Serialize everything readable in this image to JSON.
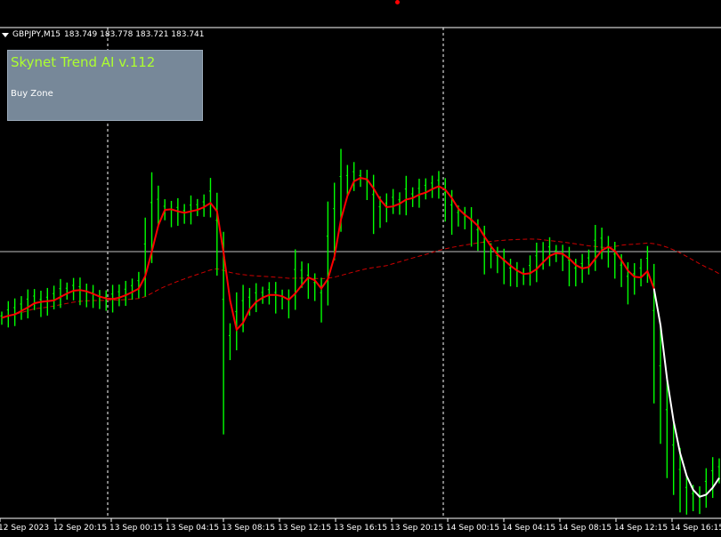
{
  "header": {
    "symbol": "GBPJPY,M15",
    "ohlc": "183.749 183.778 183.721 183.741"
  },
  "panel": {
    "title": "Skynet Trend AI v.112",
    "status": "Buy Zone"
  },
  "chart_data": {
    "type": "candlestick",
    "symbol": "GBPJPY",
    "timeframe": "M15",
    "last_ohlc": {
      "open": 183.749,
      "high": 183.778,
      "low": 183.721,
      "close": 183.741
    },
    "x_ticks": [
      "12 Sep 2023",
      "12 Sep 20:15",
      "13 Sep 00:15",
      "13 Sep 04:15",
      "13 Sep 08:15",
      "13 Sep 12:15",
      "13 Sep 16:15",
      "13 Sep 20:15",
      "14 Sep 00:15",
      "14 Sep 04:15",
      "14 Sep 08:15",
      "14 Sep 12:15",
      "14 Sep 16:15"
    ],
    "series": [
      {
        "name": "",
        "values": [
          183.52,
          183.56,
          183.58,
          183.62,
          183.66,
          183.7,
          183.66,
          183.68,
          183.72,
          183.76,
          183.78,
          183.8,
          183.78,
          183.74,
          183.73,
          183.7,
          183.69,
          183.71,
          183.74,
          183.76,
          183.8,
          183.84,
          184.12,
          184.5,
          184.6,
          184.56,
          184.52,
          184.54,
          184.52,
          184.56,
          184.58,
          184.6,
          184.68,
          184.34,
          183.42,
          183.3,
          183.5,
          183.62,
          183.68,
          183.72,
          183.74,
          183.76,
          183.72,
          183.7,
          183.66,
          183.9,
          183.94,
          183.88,
          183.82,
          183.7,
          184.16,
          184.46,
          184.76,
          184.84,
          184.88,
          184.86,
          184.8,
          184.62,
          184.54,
          184.58,
          184.64,
          184.62,
          184.7,
          184.68,
          184.72,
          184.76,
          184.78,
          184.8,
          184.66,
          184.54,
          184.5,
          184.48,
          184.4,
          184.32,
          184.18,
          184.12,
          184.08,
          184.02,
          183.96,
          183.94,
          183.92,
          183.98,
          184.06,
          184.12,
          184.16,
          184.14,
          184.1,
          184.02,
          183.96,
          184.0,
          184.06,
          184.2,
          184.24,
          184.16,
          184.08,
          183.98,
          183.86,
          183.9,
          183.96,
          184.04,
          183.4,
          182.9,
          182.5,
          182.2,
          181.98,
          181.84,
          181.8,
          181.78,
          181.9,
          182.0,
          182.06
        ]
      }
    ],
    "ylim": [
      181.6,
      186.3
    ],
    "grid": false
  },
  "colors": {
    "bull": "#00ff00",
    "bear": "#00ff00",
    "trend_line": "#ff0000",
    "trend_line_recent": "#ffffff",
    "ma_dashed": "#cc0000",
    "bid_line": "#c0c0c0",
    "separator": "#ffffff",
    "panel_bg": "#778899",
    "panel_title": "#adff2f"
  }
}
